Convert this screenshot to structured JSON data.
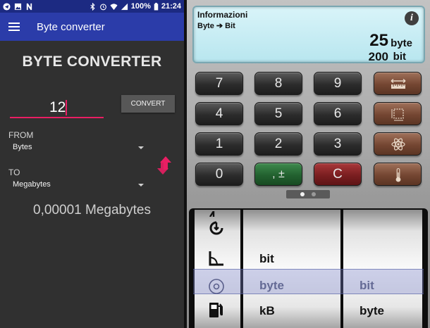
{
  "status_bar": {
    "battery": "100%",
    "time": "21:24"
  },
  "left_app": {
    "title": "Byte converter",
    "heading": "BYTE CONVERTER",
    "input_value": "12",
    "convert_label": "CONVERT",
    "from_label": "FROM",
    "from_value": "Bytes",
    "to_label": "TO",
    "to_value": "Megabytes",
    "result": "0,00001 Megabytes",
    "colors": {
      "appbar": "#2b3ca9",
      "accent": "#e91e63",
      "background": "#303030"
    }
  },
  "right_app": {
    "display": {
      "title": "Informazioni",
      "conversion": "Byte ➔ Bit",
      "value_1": "25",
      "unit_1": "byte",
      "value_2": "200",
      "unit_2": "bit",
      "info_icon": "i"
    },
    "keys": {
      "row1": [
        "7",
        "8",
        "9"
      ],
      "row2": [
        "4",
        "5",
        "6"
      ],
      "row3": [
        "1",
        "2",
        "3"
      ],
      "row4": [
        "0",
        ", ±",
        "C"
      ],
      "function_icons": [
        "ruler-icon",
        "area-icon",
        "atom-icon",
        "thermometer-icon"
      ]
    },
    "pager": {
      "pages": 2,
      "active": 1
    },
    "picker": {
      "icons": [
        "wrench-icon",
        "angle-icon",
        "speaker-icon",
        "fuel-icon"
      ],
      "col2": [
        "bit",
        "byte",
        "kB"
      ],
      "col3": [
        "bit",
        "byte"
      ]
    }
  }
}
